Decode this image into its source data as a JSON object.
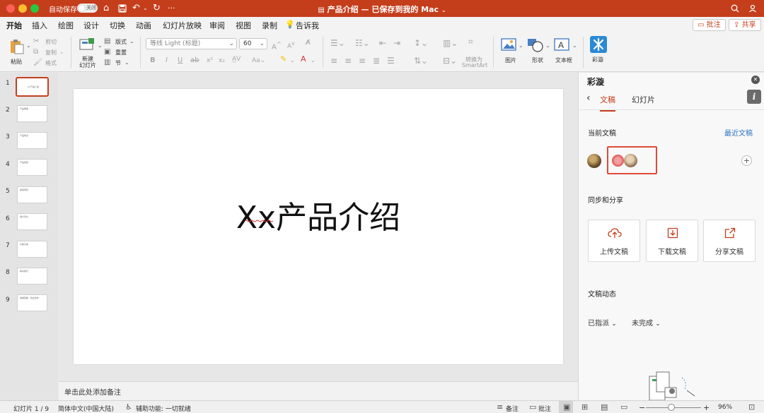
{
  "titlebar": {
    "autosave_label": "自动保存",
    "toggle_state": "关闭",
    "doc_title": "产品介绍 — 已保存到我的 Mac",
    "more": "···"
  },
  "ribbon_tabs": [
    "开始",
    "插入",
    "绘图",
    "设计",
    "切换",
    "动画",
    "幻灯片放映",
    "审阅",
    "视图",
    "录制"
  ],
  "tell_me": "告诉我",
  "comments_button": "批注",
  "share_button": "共享",
  "toolbar": {
    "paste": "粘贴",
    "cut": "剪切",
    "copy": "复制",
    "format": "格式",
    "new_slide_1": "新建",
    "new_slide_2": "幻灯片",
    "layout": "版式",
    "reset": "重置",
    "section": "节",
    "font_name": "等线 Light (标题)",
    "font_size": "60",
    "convert_1": "转换为",
    "convert_2": "SmartArt",
    "picture": "图片",
    "shapes": "形状",
    "textbox": "文本框",
    "caiyun": "彩漩"
  },
  "slides": [
    {
      "num": "1",
      "text": "Xx产品介绍"
    },
    {
      "num": "2",
      "text": "产品概述"
    },
    {
      "num": "3",
      "text": "产品特点"
    },
    {
      "num": "4",
      "text": "产品优势"
    },
    {
      "num": "5",
      "text": "使用场景"
    },
    {
      "num": "6",
      "text": "用户评价"
    },
    {
      "num": "7",
      "text": "价格方案"
    },
    {
      "num": "8",
      "text": "联系我们"
    },
    {
      "num": "9",
      "text": "谢谢观看 · 欢迎合作"
    }
  ],
  "slide_title": "Xx产品介绍",
  "notes_placeholder": "单击此处添加备注",
  "panel": {
    "title": "彩漩",
    "tab_doc": "文稿",
    "tab_slides": "幻灯片",
    "info": "i",
    "current_doc": "当前文稿",
    "recent_doc": "最近文稿",
    "sync_share": "同步和分享",
    "upload": "上传文稿",
    "download": "下载文稿",
    "share": "分享文稿",
    "activity": "文稿动态",
    "filter_assigned": "已指派",
    "filter_incomplete": "未完成"
  },
  "status": {
    "slide_pos": "幻灯片 1 / 9",
    "language": "简体中文(中国大陆)",
    "accessibility": "辅助功能: 一切就绪",
    "notes": "备注",
    "comments": "批注",
    "zoom": "96%"
  }
}
